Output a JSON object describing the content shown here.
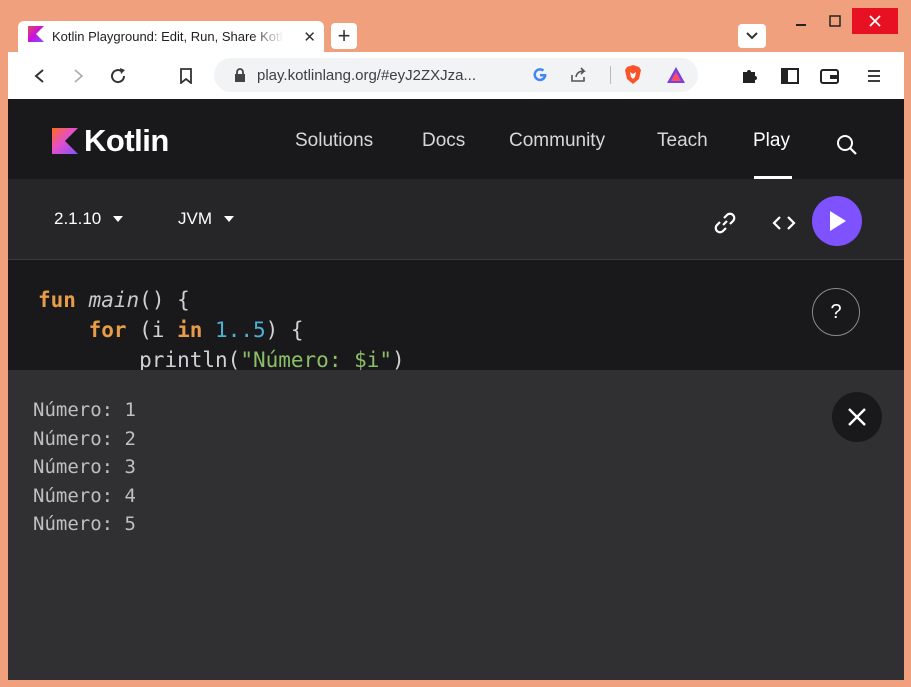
{
  "browser": {
    "tab": {
      "title": "Kotlin Playground: Edit, Run, Share Kotlin Code Online",
      "close": "✕"
    },
    "new_tab": "+",
    "address": {
      "url": "play.kotlinlang.org/#eyJ2ZXJza..."
    },
    "icons": {
      "back": "back-arrow-icon",
      "forward": "forward-arrow-icon",
      "reload": "reload-icon",
      "bookmark": "bookmark-icon",
      "lock": "lock-icon",
      "google": "google-icon",
      "share": "share-icon",
      "brave": "brave-shield-icon",
      "rewards": "brave-rewards-icon",
      "extensions": "puzzle-icon",
      "sidebar": "sidebar-icon",
      "wallet": "wallet-icon",
      "menu": "menu-icon"
    },
    "colors": {
      "frame": "#f0a07c",
      "close": "#e81123"
    }
  },
  "kotlin_header": {
    "logo_text": "Kotlin",
    "nav": [
      {
        "label": "Solutions"
      },
      {
        "label": "Docs"
      },
      {
        "label": "Community"
      },
      {
        "label": "Teach"
      },
      {
        "label": "Play",
        "active": true
      }
    ],
    "colors": {
      "bg": "#19191c",
      "accent": "#7f52ff"
    }
  },
  "editor_toolbar": {
    "version": "2.1.10",
    "platform": "JVM",
    "run_color": "#7f52ff"
  },
  "code": {
    "line1": {
      "kw": "fun",
      "name": "main",
      "rest": "() {"
    },
    "line2": {
      "kw": "for",
      "open": " (i ",
      "in": "in",
      "range": "1..5",
      "close": ") {"
    },
    "line3": {
      "fn": "println(",
      "str": "\"Número: $i\"",
      "close": ")"
    },
    "help": "?"
  },
  "output": {
    "lines": [
      "Número: 1",
      "Número: 2",
      "Número: 3",
      "Número: 4",
      "Número: 5"
    ]
  }
}
